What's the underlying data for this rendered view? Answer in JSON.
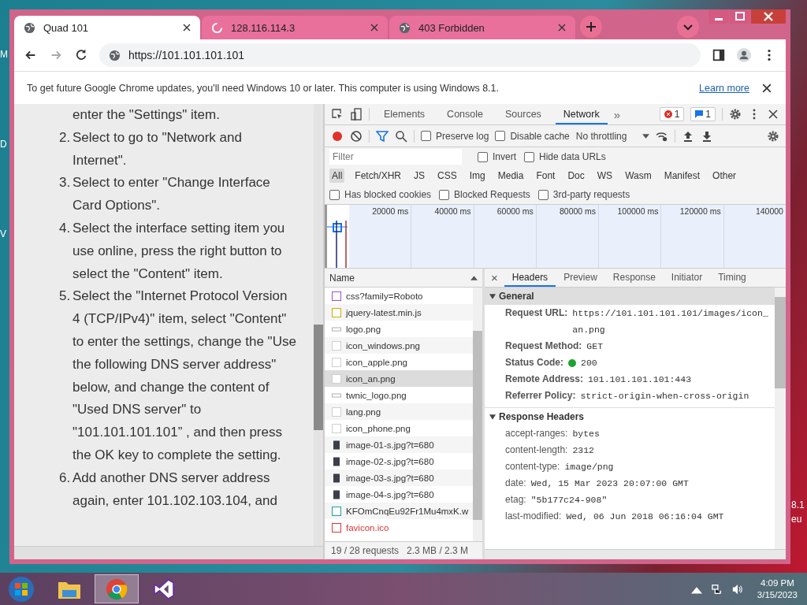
{
  "desktop": {
    "left_labels": [
      "M",
      "D",
      "V"
    ],
    "right_labels": [
      "8.1",
      "eu"
    ]
  },
  "browser": {
    "tabs": [
      {
        "title": "Quad 101",
        "selected": true,
        "loading": false
      },
      {
        "title": "128.116.114.3",
        "selected": false,
        "loading": true
      },
      {
        "title": "403 Forbidden",
        "selected": false,
        "loading": false
      }
    ],
    "url": "https://101.101.101.101",
    "infobar": {
      "message": "To get future Google Chrome updates, you'll need Windows 10 or later. This computer is using Windows 8.1.",
      "link": "Learn more"
    }
  },
  "page": {
    "items": [
      {
        "text": "enter the \"Settings\" item."
      },
      {
        "number": "2.",
        "text": "Select to go to \"Network and Internet\"."
      },
      {
        "number": "3.",
        "text": "Select to enter \"Change Interface Card Options\"."
      },
      {
        "number": "4.",
        "text": "Select the interface setting item you use online, press the right button to select the \"Content\" item."
      },
      {
        "number": "5.",
        "text": "Select the \"Internet Protocol Version 4 (TCP/IPv4)\" item, select \"Content\" to enter the settings, change the \"Use the following DNS server address\" below, and change the content of \"Used DNS server\" to \"101.101.101.101” , and then press the OK key to complete the setting."
      },
      {
        "number": "6.",
        "text": "Add another DNS server address again, enter 101.102.103.104, and"
      }
    ]
  },
  "devtools": {
    "panels": [
      {
        "label": "Elements",
        "selected": false
      },
      {
        "label": "Console",
        "selected": false
      },
      {
        "label": "Sources",
        "selected": false
      },
      {
        "label": "Network",
        "selected": true
      }
    ],
    "more": "»",
    "error_count": "1",
    "message_count": "1",
    "options": [
      {
        "label": "Preserve log",
        "checked": false
      },
      {
        "label": "Disable cache",
        "checked": false
      }
    ],
    "throttling": "No throttling",
    "filter_placeholder": "Filter",
    "filter_options": [
      {
        "label": "Invert",
        "checked": false
      },
      {
        "label": "Hide data URLs",
        "checked": false
      }
    ],
    "types": [
      {
        "label": "All",
        "selected": true
      },
      {
        "label": "Fetch/XHR",
        "selected": false
      },
      {
        "label": "JS",
        "selected": false
      },
      {
        "label": "CSS",
        "selected": false
      },
      {
        "label": "Img",
        "selected": false
      },
      {
        "label": "Media",
        "selected": false
      },
      {
        "label": "Font",
        "selected": false
      },
      {
        "label": "Doc",
        "selected": false
      },
      {
        "label": "WS",
        "selected": false
      },
      {
        "label": "Wasm",
        "selected": false
      },
      {
        "label": "Manifest",
        "selected": false
      },
      {
        "label": "Other",
        "selected": false
      }
    ],
    "extra_filters": [
      {
        "label": "Has blocked cookies",
        "checked": false
      },
      {
        "label": "Blocked Requests",
        "checked": false
      },
      {
        "label": "3rd-party requests",
        "checked": false
      }
    ],
    "timeline_ticks": [
      "20000 ms",
      "40000 ms",
      "60000 ms",
      "80000 ms",
      "100000 ms",
      "120000 ms",
      "140000"
    ],
    "requests": {
      "header": "Name",
      "rows": [
        {
          "name": "css?family=Roboto",
          "kind": "stylesheet",
          "selected": false
        },
        {
          "name": "jquery-latest.min.js",
          "kind": "script",
          "selected": false
        },
        {
          "name": "logo.png",
          "kind": "banner",
          "selected": false
        },
        {
          "name": "icon_windows.png",
          "kind": "image",
          "selected": false
        },
        {
          "name": "icon_apple.png",
          "kind": "image",
          "selected": false
        },
        {
          "name": "icon_an.png",
          "kind": "image",
          "selected": true
        },
        {
          "name": "twnic_logo.png",
          "kind": "banner",
          "selected": false
        },
        {
          "name": "lang.png",
          "kind": "image",
          "selected": false
        },
        {
          "name": "icon_phone.png",
          "kind": "image",
          "selected": false
        },
        {
          "name": "image-01-s.jpg?t=680",
          "kind": "photo",
          "selected": false
        },
        {
          "name": "image-02-s.jpg?t=680",
          "kind": "photo",
          "selected": false
        },
        {
          "name": "image-03-s.jpg?t=680",
          "kind": "photo",
          "selected": false
        },
        {
          "name": "image-04-s.jpg?t=680",
          "kind": "photo",
          "selected": false
        },
        {
          "name": "KFOmCnqEu92Fr1Mu4mxK.w",
          "kind": "font",
          "selected": false
        },
        {
          "name": "favicon.ico",
          "kind": "failed",
          "selected": false
        }
      ],
      "summary": [
        "19 / 28 requests",
        "2.3 MB / 2.3 M"
      ]
    },
    "details": {
      "close": "×",
      "tabs": [
        {
          "label": "Headers",
          "selected": true
        },
        {
          "label": "Preview",
          "selected": false
        },
        {
          "label": "Response",
          "selected": false
        },
        {
          "label": "Initiator",
          "selected": false
        },
        {
          "label": "Timing",
          "selected": false
        }
      ],
      "sections": [
        {
          "title": "General",
          "kind": "general",
          "expanded": true,
          "rows": [
            {
              "key": "Request URL:",
              "value": "https://101.101.101.101/images/icon_an.png",
              "kind": "plain"
            },
            {
              "key": "Request Method:",
              "value": "GET",
              "kind": "plain"
            },
            {
              "key": "Status Code:",
              "value": "200",
              "kind": "status"
            },
            {
              "key": "Remote Address:",
              "value": "101.101.101.101:443",
              "kind": "plain"
            },
            {
              "key": "Referrer Policy:",
              "value": "strict-origin-when-cross-origin",
              "kind": "plain"
            }
          ]
        },
        {
          "title": "Response Headers",
          "kind": "headers",
          "expanded": true,
          "rows": [
            {
              "key": "accept-ranges:",
              "value": "bytes",
              "kind": "plain"
            },
            {
              "key": "content-length:",
              "value": "2312",
              "kind": "plain"
            },
            {
              "key": "content-type:",
              "value": "image/png",
              "kind": "plain"
            },
            {
              "key": "date:",
              "value": "Wed, 15 Mar 2023 20:07:00 GMT",
              "kind": "plain"
            },
            {
              "key": "etag:",
              "value": "\"5b177c24-908\"",
              "kind": "plain"
            },
            {
              "key": "last-modified:",
              "value": "Wed, 06 Jun 2018 06:16:04 GMT",
              "kind": "plain"
            }
          ]
        }
      ]
    }
  },
  "taskbar": {
    "time": "4:09 PM",
    "date": "3/15/2023"
  }
}
